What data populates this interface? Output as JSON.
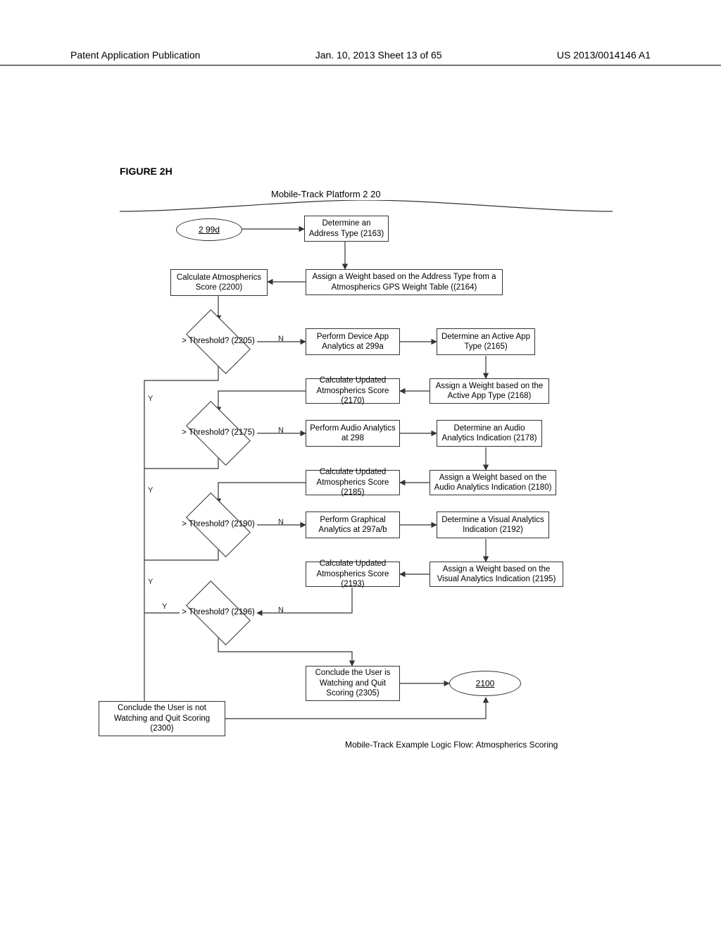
{
  "header": {
    "left": "Patent Application Publication",
    "center": "Jan. 10, 2013  Sheet 13 of 65",
    "right": "US 2013/0014146 A1"
  },
  "figure": {
    "title": "FIGURE 2H",
    "platform_label": "Mobile-Track  Platform 2 20",
    "caption": "Mobile-Track Example Logic Flow: Atmospherics Scoring"
  },
  "nodes": {
    "start": "2 99d",
    "b1": "Determine an Address Type (2163)",
    "b2": "Calculate Atmospherics Score (2200)",
    "b3": "Assign a Weight based on the Address Type from a Atmospherics GPS Weight Table ((2164)",
    "d1": "> Threshold? (2205)",
    "b4": "Perform Device App Analytics at 299a",
    "b5": "Determine an Active App Type (2165)",
    "b6": "Calculate Updated Atmospherics Score (2170)",
    "b7": "Assign a Weight based on the Active App Type (2168)",
    "d2": "> Threshold? (2175)",
    "b8": "Perform Audio Analytics at 298",
    "b9": "Determine an Audio Analytics Indication (2178)",
    "b10": "Calculate Updated Atmospherics Score (2185)",
    "b11": "Assign a Weight based on the Audio Analytics Indication (2180)",
    "d3": "> Threshold? (2190)",
    "b12": "Perform Graphical Analytics at 297a/b",
    "b13": "Determine a Visual Analytics Indication (2192)",
    "b14": "Calculate Updated Atmospherics Score (2193)",
    "b15": "Assign a Weight based on the Visual Analytics Indication (2195)",
    "d4": "> Threshold? (2196)",
    "b16": "Conclude the User is Watching and Quit Scoring (2305)",
    "b17": "Conclude the User is not Watching and Quit Scoring (2300)",
    "end": "2100"
  },
  "labels": {
    "Y": "Y",
    "N": "N"
  }
}
